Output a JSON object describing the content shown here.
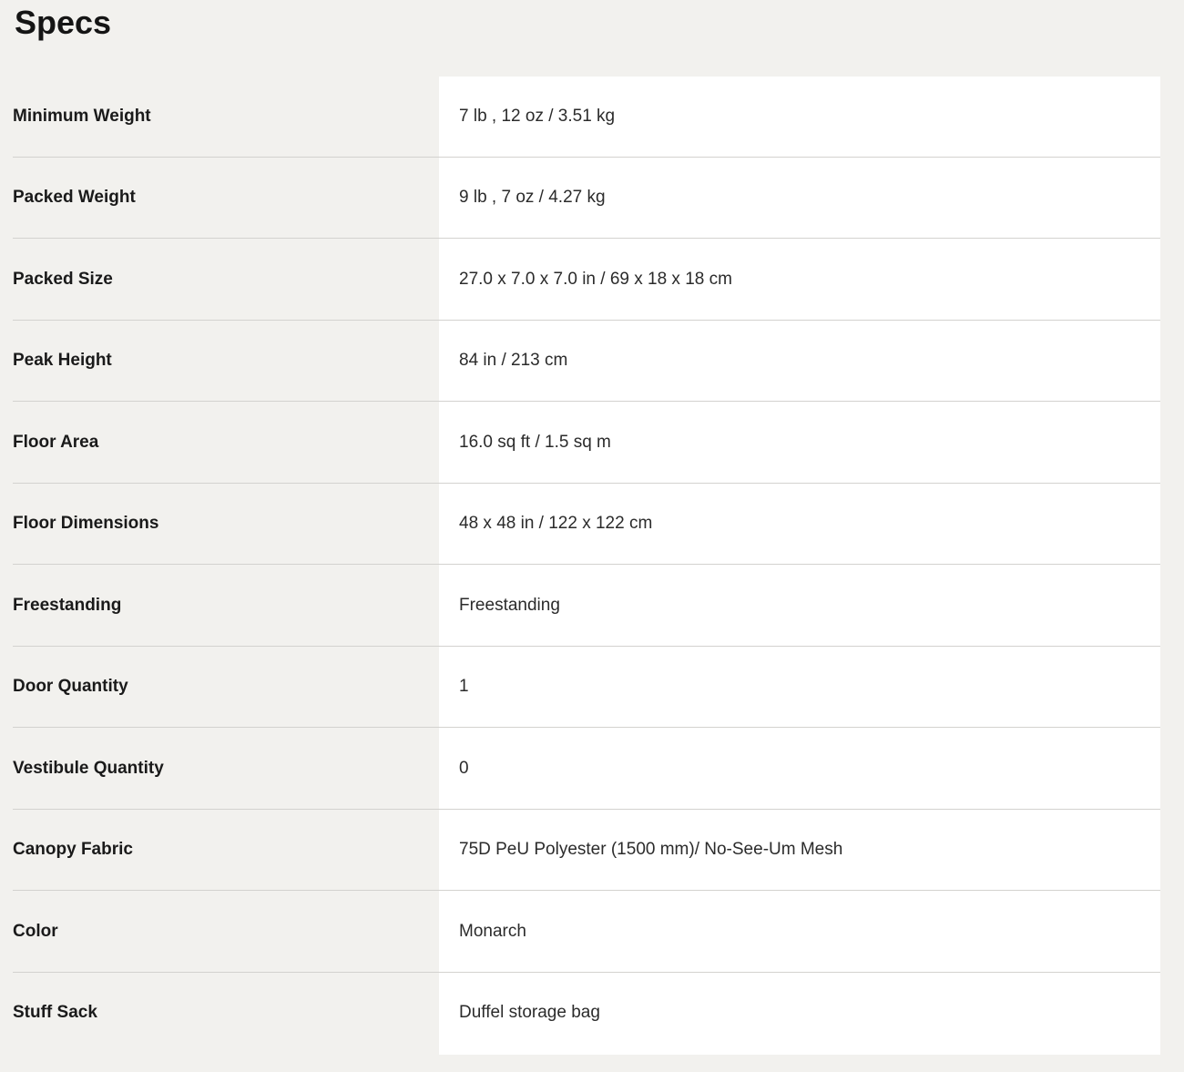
{
  "title": "Specs",
  "specs": [
    {
      "label": "Minimum Weight",
      "value": "7 lb , 12 oz / 3.51 kg"
    },
    {
      "label": "Packed Weight",
      "value": "9 lb , 7 oz / 4.27 kg"
    },
    {
      "label": "Packed Size",
      "value": "27.0 x 7.0 x 7.0 in / 69 x 18 x 18 cm"
    },
    {
      "label": "Peak Height",
      "value": "84 in / 213 cm"
    },
    {
      "label": "Floor Area",
      "value": "16.0 sq ft / 1.5 sq m"
    },
    {
      "label": "Floor Dimensions",
      "value": "48 x 48 in / 122 x 122 cm"
    },
    {
      "label": "Freestanding",
      "value": "Freestanding"
    },
    {
      "label": "Door Quantity",
      "value": "1"
    },
    {
      "label": "Vestibule Quantity",
      "value": "0"
    },
    {
      "label": "Canopy Fabric",
      "value": "75D PeU Polyester (1500 mm)/ No-See-Um Mesh"
    },
    {
      "label": "Color",
      "value": "Monarch"
    },
    {
      "label": "Stuff Sack",
      "value": "Duffel storage bag"
    }
  ],
  "colors": {
    "page_background": "#f2f1ee",
    "value_panel": "#ffffff",
    "divider": "#d3d2cf",
    "text": "#1f1f1f"
  }
}
